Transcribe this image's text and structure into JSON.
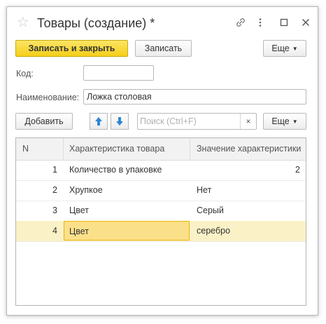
{
  "window": {
    "title": "Товары (создание) *",
    "star": "☆",
    "link_icon": "🔗",
    "more_icon": "⋮",
    "maximize_icon": "☐",
    "close_icon": "✕"
  },
  "toolbar": {
    "save_close_label": "Записать и закрыть",
    "save_label": "Записать",
    "more_label": "Еще"
  },
  "form": {
    "code_label": "Код:",
    "code_value": "",
    "name_label": "Наименование:",
    "name_value": "Ложка столовая"
  },
  "table_toolbar": {
    "add_label": "Добавить",
    "search_placeholder": "Поиск (Ctrl+F)",
    "clear_icon": "×",
    "more_label": "Еще"
  },
  "table": {
    "columns": [
      "N",
      "Характеристика товара",
      "Значение характеристики"
    ],
    "rows": [
      {
        "n": "1",
        "characteristic": "Количество в упаковке",
        "value": "2"
      },
      {
        "n": "2",
        "characteristic": "Хрупкое",
        "value": "Нет"
      },
      {
        "n": "3",
        "characteristic": "Цвет",
        "value": "Серый"
      },
      {
        "n": "4",
        "characteristic": "Цвет",
        "value": "серебро"
      }
    ]
  },
  "colors": {
    "primary_button": "#f5cf1a",
    "selected_row": "#fbf1c6",
    "active_cell": "#fbe08a"
  }
}
